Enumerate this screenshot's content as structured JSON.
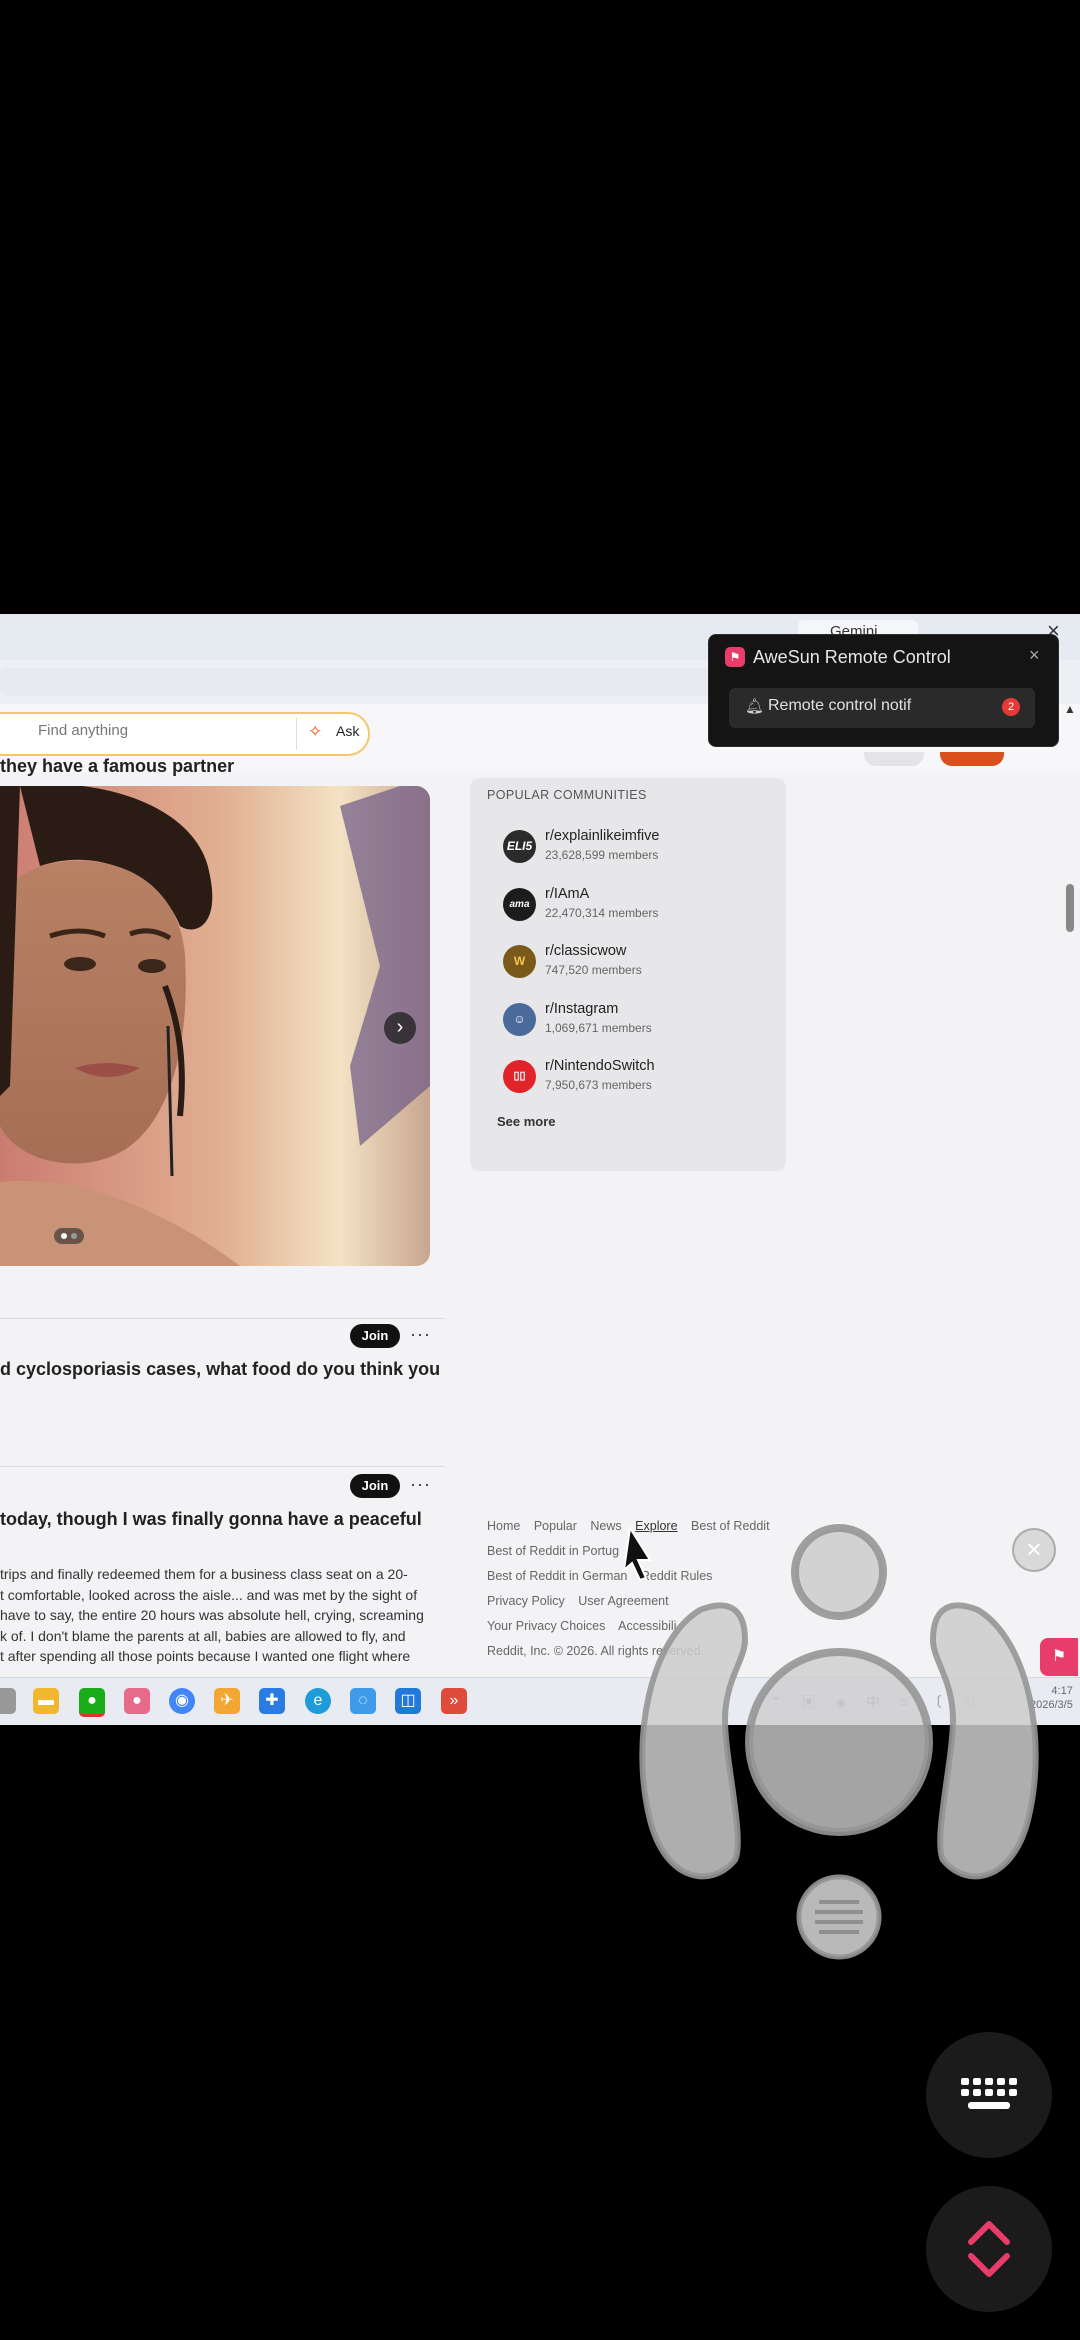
{
  "browser": {
    "tab_label": "Gemini",
    "close_label": "×"
  },
  "reddit": {
    "search_placeholder": "Find anything",
    "ask_label": "Ask"
  },
  "feed": {
    "post1_title": "they have a famous partner",
    "join_label": "Join",
    "more_label": "···",
    "post2_title": "d cyclosporiasis cases, what food do you think you",
    "post3_title": "today, though I was finally gonna have a peaceful",
    "post3_body": [
      "trips and finally redeemed them for a business class seat on a 20-",
      "t comfortable, looked across the aisle... and was met by the sight of",
      "have to say, the entire 20 hours was absolute hell, crying, screaming",
      "k of. I don't blame the parents at all, babies are allowed to fly, and",
      "t after spending all those points because I wanted one flight where"
    ]
  },
  "sidebar": {
    "title": "POPULAR COMMUNITIES",
    "communities": [
      {
        "name": "r/explainlikeimfive",
        "members": "23,628,599 members",
        "icon_text": "ELI5",
        "color": "#2b2b2b"
      },
      {
        "name": "r/IAmA",
        "members": "22,470,314 members",
        "icon_text": "ama",
        "color": "#1c1c1c"
      },
      {
        "name": "r/classicwow",
        "members": "747,520 members",
        "icon_text": "W",
        "color": "#7a5a1a"
      },
      {
        "name": "r/Instagram",
        "members": "1,069,671 members",
        "icon_text": "☺",
        "color": "#4a6a9a"
      },
      {
        "name": "r/NintendoSwitch",
        "members": "7,950,673 members",
        "icon_text": "▯▯",
        "color": "#e2242a"
      }
    ],
    "see_more": "See more"
  },
  "footer": {
    "row1": [
      "Home",
      "Popular",
      "News",
      "Explore",
      "Best of Reddit"
    ],
    "row2": [
      "Best of Reddit in Portug"
    ],
    "row3": [
      "Best of Reddit in German",
      "Reddit Rules"
    ],
    "row4": [
      "Privacy Policy",
      "User Agreement"
    ],
    "row5": [
      "Your Privacy Choices",
      "Accessibili"
    ],
    "copyright": "Reddit, Inc. © 2026. All rights reserved."
  },
  "taskbar": {
    "clock_time": "4:17",
    "clock_date": "2026/3/5"
  },
  "notification": {
    "app_title": "AweSun Remote Control",
    "close_label": "×",
    "message": "Remote control notif",
    "badge_count": "2"
  },
  "overlay": {
    "close_label": "×"
  },
  "colors": {
    "reddit_orange": "#d9501c",
    "awesun_pink": "#e83c6b",
    "badge_red": "#e53935"
  }
}
